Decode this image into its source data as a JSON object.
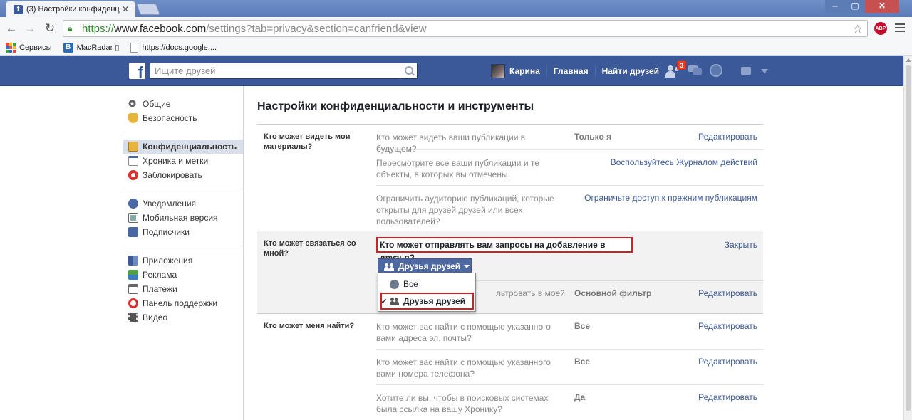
{
  "browser": {
    "tab_title": "(3) Настройки конфиденц",
    "url_https": "https://",
    "url_host": "www.facebook.com",
    "url_rest": "/settings?tab=privacy&section=canfriend&view",
    "abp_label": "ABP",
    "bookmarks": [
      {
        "label": "Сервисы",
        "icon": "apps-grid-icon"
      },
      {
        "label": "MacRadar ▯",
        "icon": "macradar-icon"
      },
      {
        "label": "https://docs.google....",
        "icon": "page-icon"
      }
    ]
  },
  "fb": {
    "logo": "f",
    "search_placeholder": "Ищите друзей",
    "user_name": "Карина",
    "nav_home": "Главная",
    "nav_find_friends": "Найти друзей",
    "friend_requests_badge": "3"
  },
  "sidebar": {
    "groups": [
      [
        {
          "label": "Общие",
          "icon": "gear-icon"
        },
        {
          "label": "Безопасность",
          "icon": "shield-icon"
        }
      ],
      [
        {
          "label": "Конфиденциальность",
          "icon": "lock-icon",
          "active": true
        },
        {
          "label": "Хроника и метки",
          "icon": "timeline-icon"
        },
        {
          "label": "Заблокировать",
          "icon": "block-icon"
        }
      ],
      [
        {
          "label": "Уведомления",
          "icon": "globe-icon"
        },
        {
          "label": "Мобильная версия",
          "icon": "mobile-icon"
        },
        {
          "label": "Подписчики",
          "icon": "rss-icon"
        }
      ],
      [
        {
          "label": "Приложения",
          "icon": "apps-icon"
        },
        {
          "label": "Реклама",
          "icon": "ads-icon"
        },
        {
          "label": "Платежи",
          "icon": "card-icon"
        },
        {
          "label": "Панель поддержки",
          "icon": "lifebuoy-icon"
        },
        {
          "label": "Видео",
          "icon": "film-icon"
        }
      ]
    ]
  },
  "main": {
    "title": "Настройки конфиденциальности и инструменты",
    "sections": [
      {
        "label": "Кто может видеть мои материалы?",
        "rows": [
          {
            "q": "Кто может видеть ваши публикации в будущем?",
            "v": "Только я",
            "a": "Редактировать"
          },
          {
            "q": "Пересмотрите все ваши публикации и те объекты, в которых вы отмечены.",
            "v": "",
            "a": "Воспользуйтесь Журналом действий"
          },
          {
            "q": "Ограничить аудиторию публикаций, которые открыты для друзей друзей или всех пользователей?",
            "v": "",
            "a": "Ограничьте доступ к прежним публикациям"
          }
        ]
      },
      {
        "label": "Кто может связаться со мной?",
        "expanded_q": "Кто может отправлять вам запросы на добавление в друзья?",
        "expanded_close": "Закрыть",
        "selected_value": "Друзья друзей",
        "sub_row": {
          "q": "льтровать в моей",
          "v": "Основной фильтр",
          "a": "Редактировать"
        }
      },
      {
        "label": "Кто может меня найти?",
        "rows": [
          {
            "q": "Кто может вас найти с помощью указанного вами адреса эл. почты?",
            "v": "Все",
            "a": "Редактировать"
          },
          {
            "q": "Кто может вас найти с помощью указанного вами номера телефона?",
            "v": "Все",
            "a": "Редактировать"
          },
          {
            "q": "Хотите ли вы, чтобы в поисковых системах была ссылка на вашу Хронику?",
            "v": "Да",
            "a": "Редактировать"
          }
        ]
      }
    ],
    "dropdown": {
      "options": [
        {
          "label": "Все",
          "icon": "globe-icon",
          "checked": false
        },
        {
          "label": "Друзья друзей",
          "icon": "people-icon",
          "checked": true
        }
      ],
      "check_glyph": "✓"
    }
  },
  "colors": {
    "fb_blue": "#3b5998",
    "highlight_red": "#d21f1f",
    "link": "#3b5998"
  }
}
